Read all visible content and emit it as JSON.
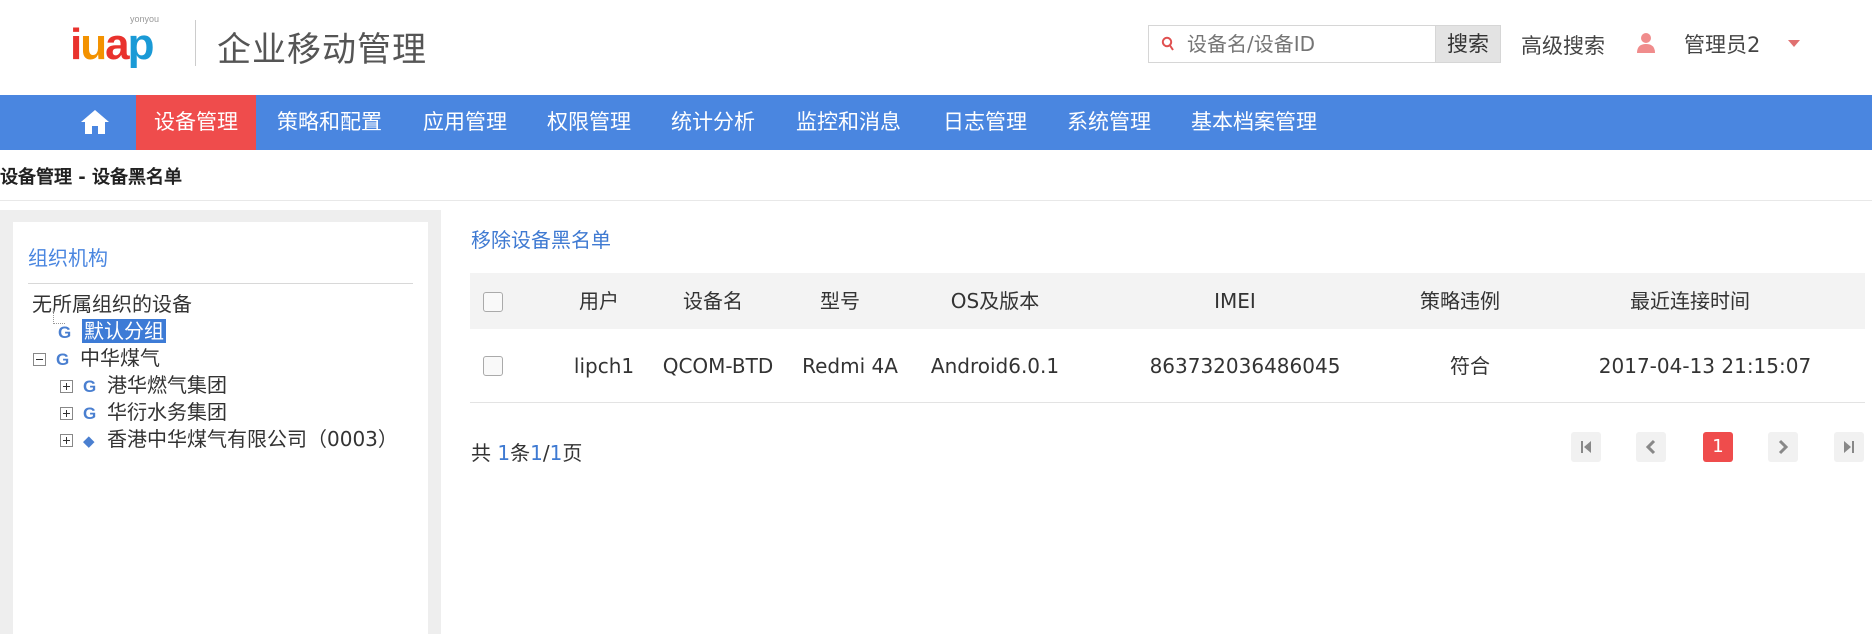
{
  "header": {
    "logo_small": "yonyou",
    "logo_text": [
      "i",
      "u",
      "a",
      "p"
    ],
    "app_title": "企业移动管理",
    "search_placeholder": "设备名/设备ID",
    "search_button": "搜索",
    "advanced_search": "高级搜索",
    "user_name": "管理员2"
  },
  "nav": {
    "items": [
      "设备管理",
      "策略和配置",
      "应用管理",
      "权限管理",
      "统计分析",
      "监控和消息",
      "日志管理",
      "系统管理",
      "基本档案管理"
    ],
    "active_index": 0
  },
  "breadcrumb": "设备管理 -  设备黑名单",
  "left_panel": {
    "title": "组织机构",
    "tree": [
      {
        "label": "无所属组织的设备"
      },
      {
        "label": "默认分组",
        "selected": true
      },
      {
        "label": "中华煤气"
      },
      {
        "label": "港华燃气集团"
      },
      {
        "label": "华衍水务集团"
      },
      {
        "label": "香港中华煤气有限公司（0003）"
      }
    ]
  },
  "main": {
    "remove_link": "移除设备黑名单",
    "columns": [
      "用户",
      "设备名",
      "型号",
      "OS及版本",
      "IMEI",
      "策略违例",
      "最近连接时间"
    ],
    "rows": [
      {
        "user": "lipch1",
        "device": "QCOM-BTD",
        "model": "Redmi 4A",
        "os": "Android6.0.1",
        "imei": "863732036486045",
        "policy": "符合",
        "last_conn": "2017-04-13 21:15:07"
      }
    ],
    "pager": {
      "prefix": "共",
      "total": "1",
      "mid": "条",
      "page": "1",
      "sep": "/",
      "pages": "1",
      "suffix": "页",
      "current_page": "1"
    }
  },
  "colors": {
    "nav_bg": "#4a86e0",
    "nav_active": "#ef4c4c",
    "link": "#3f7ad2",
    "accent_red": "#ef4c4c"
  }
}
